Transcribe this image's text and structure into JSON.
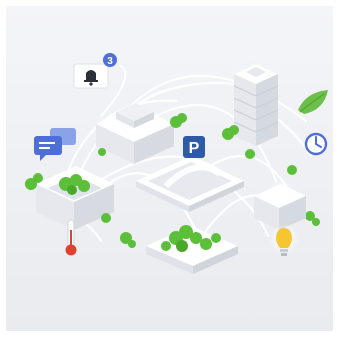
{
  "notification": {
    "count": "3",
    "icon": "bell-icon"
  },
  "parking": {
    "label": "P",
    "icon": "parking-sign-icon",
    "color": "#2f5aa8"
  },
  "icons": {
    "chat": "chat-bubbles-icon",
    "thermometer": "thermometer-icon",
    "leaf": "leaf-icon",
    "clock": "clock-icon",
    "lightbulb": "lightbulb-icon"
  },
  "colors": {
    "background": "#eef0f3",
    "connection": "#ffffff",
    "tree": "#5cbf3a",
    "building": "#f4f5f8",
    "accent_blue": "#4f6fd6",
    "bulb": "#f7c531",
    "thermo_red": "#e0412f",
    "leaf": "#6cc04a"
  }
}
